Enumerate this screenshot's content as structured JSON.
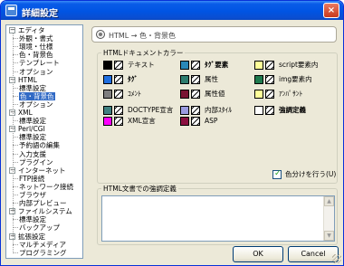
{
  "window": {
    "title": "詳細設定",
    "close_label": "×"
  },
  "tree": {
    "items": [
      {
        "label": "エディタ",
        "level": 0,
        "expanded": true
      },
      {
        "label": "外観・書式",
        "level": 1
      },
      {
        "label": "環境・仕様",
        "level": 1
      },
      {
        "label": "色・背景色",
        "level": 1
      },
      {
        "label": "テンプレート",
        "level": 1
      },
      {
        "label": "オプション",
        "level": 1
      },
      {
        "label": "HTML",
        "level": 0,
        "expanded": true
      },
      {
        "label": "標準設定",
        "level": 1
      },
      {
        "label": "色・背景色",
        "level": 1,
        "selected": true
      },
      {
        "label": "オプション",
        "level": 1
      },
      {
        "label": "XML",
        "level": 0,
        "expanded": true
      },
      {
        "label": "標準設定",
        "level": 1
      },
      {
        "label": "Perl/CGI",
        "level": 0,
        "expanded": true
      },
      {
        "label": "標準設定",
        "level": 1
      },
      {
        "label": "予約語の編集",
        "level": 1
      },
      {
        "label": "入力支援",
        "level": 1
      },
      {
        "label": "プラグイン",
        "level": 1
      },
      {
        "label": "インターネット",
        "level": 0,
        "expanded": true
      },
      {
        "label": "FTP接続",
        "level": 1
      },
      {
        "label": "ネットワーク接続",
        "level": 1
      },
      {
        "label": "ブラウザ",
        "level": 1
      },
      {
        "label": "内部プレビュー",
        "level": 1
      },
      {
        "label": "ファイルシステム",
        "level": 0,
        "expanded": true
      },
      {
        "label": "標準設定",
        "level": 1
      },
      {
        "label": "バックアップ",
        "level": 1
      },
      {
        "label": "拡張設定",
        "level": 0,
        "expanded": true
      },
      {
        "label": "マルチメディア",
        "level": 1
      },
      {
        "label": "プログラミング",
        "level": 1
      }
    ]
  },
  "header": {
    "text": "HTML → 色・背景色"
  },
  "color_group": {
    "legend": "HTMLドキュメントカラー",
    "items": [
      {
        "label": "テキスト",
        "color": "#000000",
        "bold": false
      },
      {
        "label": "ﾀｸﾞ要素",
        "color": "#2a88b8",
        "bold": true
      },
      {
        "label": "script要素内",
        "color": "#ffff99",
        "bold": false
      },
      {
        "label": "ﾀｸﾞ",
        "color": "#1f6fe0",
        "bold": true
      },
      {
        "label": "属性",
        "color": "#2e7d6f",
        "bold": false
      },
      {
        "label": "img要素内",
        "color": "#1e7a4e",
        "bold": false
      },
      {
        "label": "ｺﾒﾝﾄ",
        "color": "#7f7f7f",
        "bold": false
      },
      {
        "label": "属性値",
        "color": "#7a1432",
        "bold": false
      },
      {
        "label": "ｱﾝﾊﾟｻﾝﾄ",
        "color": "#ffff99",
        "bold": false
      },
      {
        "label": "DOCTYPE宣言",
        "color": "#3f8080",
        "bold": false
      },
      {
        "label": "内部ｽﾀｲﾙ",
        "color": "#9b9be0",
        "bold": false
      },
      {
        "label": "強調定義",
        "color": "#ffffff",
        "bold": true
      },
      {
        "label": "XML宣言",
        "color": "#ff00ff",
        "bold": false
      },
      {
        "label": "ASP",
        "color": "#8b1040",
        "bold": false
      }
    ],
    "checkbox_label": "色分けを行う(U)"
  },
  "emphasis_group": {
    "legend": "HTML文書での強調定義"
  },
  "buttons": {
    "ok": "OK",
    "cancel": "Cancel"
  }
}
